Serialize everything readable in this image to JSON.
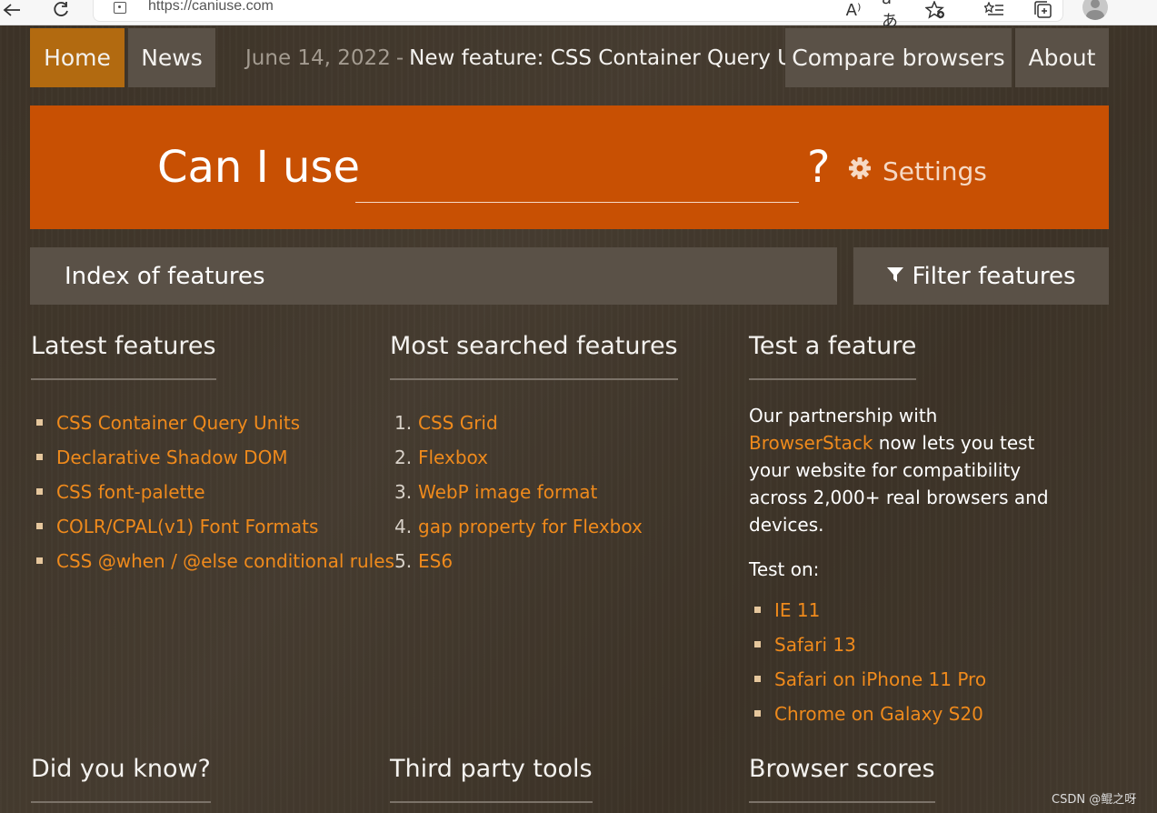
{
  "browser": {
    "url": "https://caniuse.com",
    "icons": [
      "back-arrow-icon",
      "refresh-icon",
      "site-info-icon",
      "read-aloud-icon",
      "translate-icon",
      "add-favorite-icon",
      "favorites-icon",
      "collections-icon",
      "profile-icon"
    ],
    "read_aloud_glyph": "A⁾",
    "translate_glyph": "aあ"
  },
  "nav": {
    "home": "Home",
    "news": "News",
    "news_date": "June 14, 2022",
    "news_dash": "-",
    "news_text": "New feature: CSS Container Query Units",
    "compare": "Compare browsers",
    "about": "About"
  },
  "search": {
    "prefix": "Can I use",
    "value": "",
    "suffix": "?",
    "settings_label": "Settings"
  },
  "index": {
    "title": "Index of features",
    "filter_label": "Filter features"
  },
  "latest": {
    "title": "Latest features",
    "items": [
      "CSS Container Query Units",
      "Declarative Shadow DOM",
      "CSS font-palette",
      "COLR/CPAL(v1) Font Formats",
      "CSS @when / @else conditional rules"
    ]
  },
  "most_searched": {
    "title": "Most searched features",
    "items": [
      {
        "num": "1.",
        "label": "CSS Grid"
      },
      {
        "num": "2.",
        "label": "Flexbox"
      },
      {
        "num": "3.",
        "label": "WebP image format"
      },
      {
        "num": "4.",
        "label": "gap property for Flexbox"
      },
      {
        "num": "5.",
        "label": "ES6"
      }
    ]
  },
  "test_feature": {
    "title": "Test a feature",
    "text_before": "Our partnership with ",
    "link": "BrowserStack",
    "text_after": " now lets you test your website for compatibility across 2,000+ real browsers and devices.",
    "test_on": "Test on:",
    "items": [
      "IE 11",
      "Safari 13",
      "Safari on iPhone 11 Pro",
      "Chrome on Galaxy S20"
    ]
  },
  "bottom": {
    "did_you_know": "Did you know?",
    "third_party": "Third party tools",
    "browser_scores": "Browser scores"
  },
  "watermark": "CSDN @鲲之呀",
  "colors": {
    "background": "#3f3529",
    "active_tab": "#b26a10",
    "banner": "#c85003",
    "panel": "#5a5147",
    "link": "#ef8a1c"
  }
}
